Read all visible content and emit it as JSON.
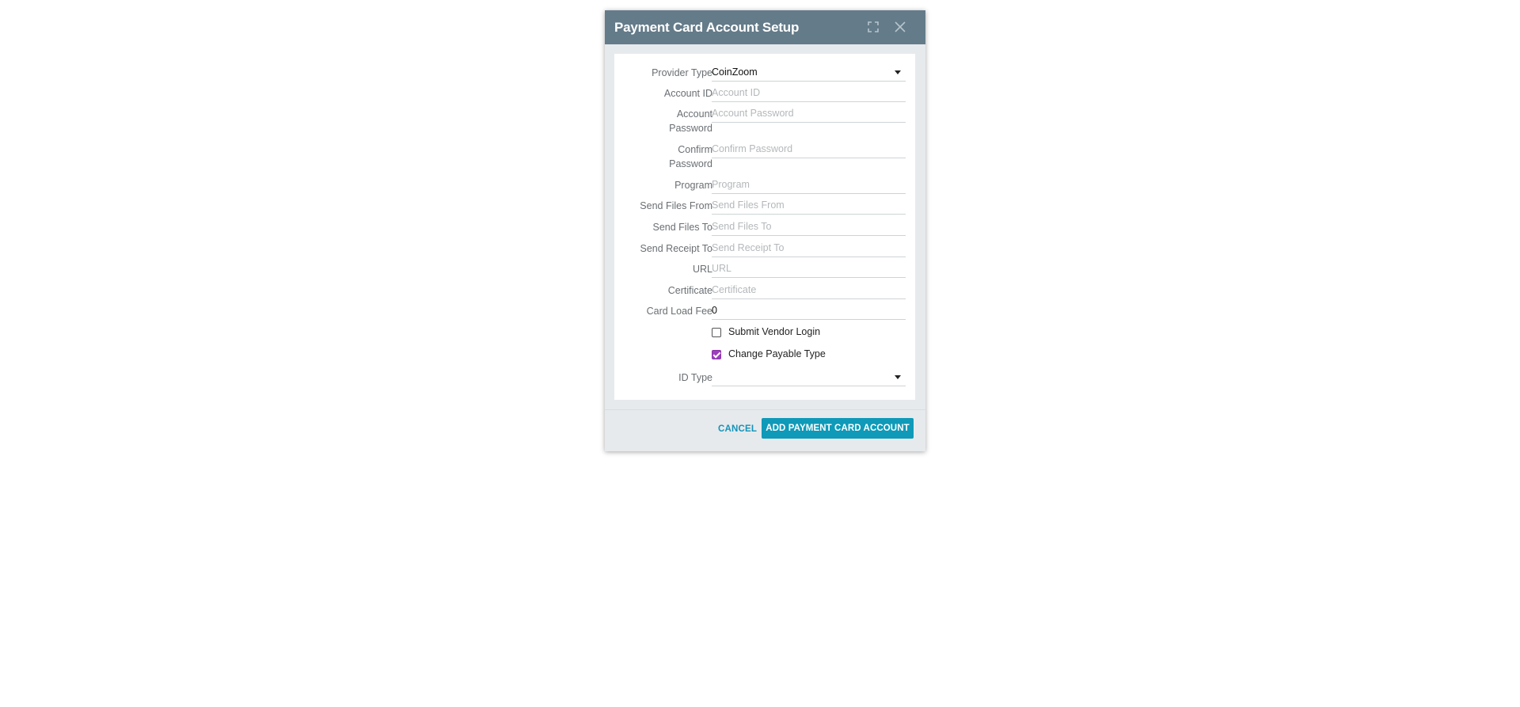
{
  "dialog": {
    "title": "Payment Card Account Setup",
    "maximize_icon": "maximize-icon",
    "close_icon": "close-icon"
  },
  "form": {
    "provider_type": {
      "label": "Provider Type",
      "value": "CoinZoom"
    },
    "account_id": {
      "label": "Account ID",
      "placeholder": "Account ID",
      "value": ""
    },
    "account_password": {
      "label_line1": "Account",
      "label_line2": "Password",
      "placeholder": "Account Password",
      "value": ""
    },
    "confirm_password": {
      "label_line1": "Confirm",
      "label_line2": "Password",
      "placeholder": "Confirm Password",
      "value": ""
    },
    "program": {
      "label": "Program",
      "placeholder": "Program",
      "value": ""
    },
    "send_files_from": {
      "label": "Send Files From",
      "placeholder": "Send Files From",
      "value": ""
    },
    "send_files_to": {
      "label": "Send Files To",
      "placeholder": "Send Files To",
      "value": ""
    },
    "send_receipt_to": {
      "label": "Send Receipt To",
      "placeholder": "Send Receipt To",
      "value": ""
    },
    "url": {
      "label": "URL",
      "placeholder": "URL",
      "value": ""
    },
    "certificate": {
      "label": "Certificate",
      "placeholder": "Certificate",
      "value": ""
    },
    "card_load_fee": {
      "label": "Card Load Fee",
      "value": "0"
    },
    "submit_vendor_login": {
      "label": "Submit Vendor Login",
      "checked": false
    },
    "change_payable_type": {
      "label": "Change Payable Type",
      "checked": true
    },
    "id_type": {
      "label": "ID Type",
      "value": ""
    }
  },
  "footer": {
    "cancel_label": "CANCEL",
    "submit_label": "ADD PAYMENT CARD ACCOUNT"
  },
  "colors": {
    "titlebar": "#647b89",
    "primary": "#0e9ab8",
    "checkbox_checked": "#9c3fbf"
  }
}
